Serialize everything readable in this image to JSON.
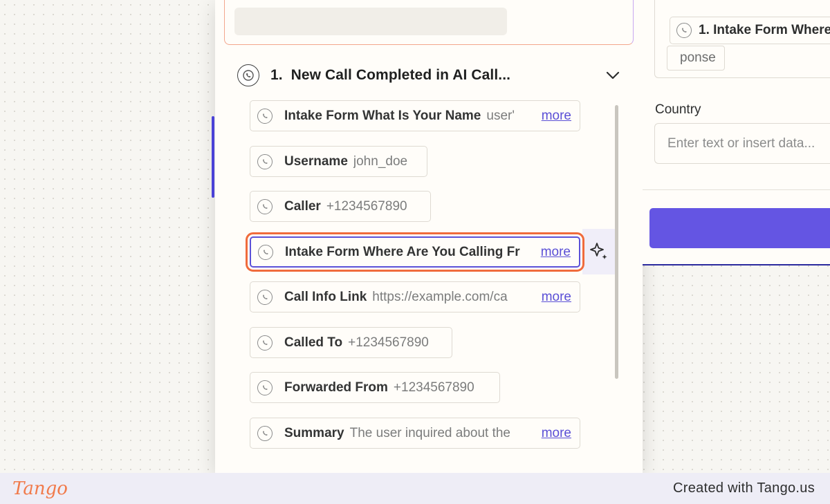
{
  "step": {
    "number": "1.",
    "title": "New Call Completed in AI Call..."
  },
  "fields": [
    {
      "label": "Intake Form What Is Your Name",
      "value": "user'",
      "more": "more"
    },
    {
      "label": "Username",
      "value": "john_doe",
      "more": ""
    },
    {
      "label": "Caller",
      "value": "+1234567890",
      "more": ""
    },
    {
      "label": "Intake Form Where Are You Calling Fr",
      "value": "",
      "more": "more"
    },
    {
      "label": "Call Info Link",
      "value": "https://example.com/ca",
      "more": "more"
    },
    {
      "label": "Called To",
      "value": "+1234567890",
      "more": ""
    },
    {
      "label": "Forwarded From",
      "value": "+1234567890",
      "more": ""
    },
    {
      "label": "Summary",
      "value": "The user inquired about the",
      "more": "more"
    }
  ],
  "form": {
    "email_chip": "1. Intake Form Where",
    "email_chip_tail": "ponse",
    "country_label": "Country",
    "country_placeholder": "Enter text or insert data..."
  },
  "footer": {
    "logo": "Tango",
    "credit": "Created with Tango.us"
  },
  "colors": {
    "accent": "#6455e3",
    "highlight": "#f06b3c",
    "link": "#5a4fd6"
  },
  "icons": [
    "app-step-icon",
    "chevron-down-icon",
    "ai-sparkle-icon"
  ]
}
